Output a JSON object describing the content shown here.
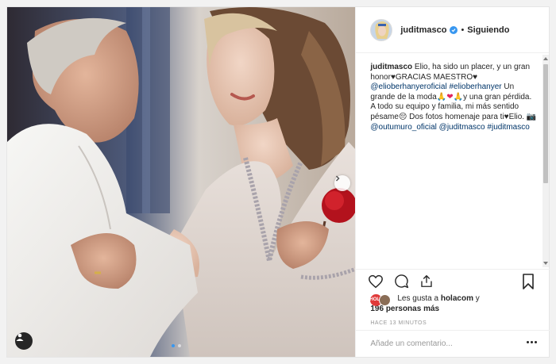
{
  "header": {
    "username": "juditmasco",
    "separator": "•",
    "follow_status": "Siguiendo"
  },
  "caption": {
    "username": "juditmasco",
    "text_1": " Elio, ha sido un placer, y un gran honor",
    "heart": "♥",
    "text_2": "GRACIAS MAESTRO",
    "heart2": "♥",
    "tag_1": "@elioberhanyeroficial",
    "tag_2": "#elioberhanyer",
    "text_3": " Un grande de la moda",
    "emoji_pray": "🙏",
    "emoji_heart": "❤",
    "emoji_pray2": "🙏",
    "text_4": "y una gran pérdida. A todo su equipo y familia, mi más sentido pésame",
    "emoji_sad": "😔",
    "text_5": " Dos fotos homenaje para ti",
    "heart3": "♥",
    "text_6": "Elio. ",
    "emoji_camera": "📷",
    "tag_3": "@outumuro_oficial",
    "tag_4": "@juditmasco",
    "tag_5": "#juditmasco"
  },
  "likes": {
    "avatar_label": "HOLA",
    "prefix": "Les gusta a ",
    "user": "holacom",
    "conj": " y",
    "count": "196 personas más"
  },
  "timestamp": "HACE 13 MINUTOS",
  "comment": {
    "placeholder": "Añade un comentario..."
  },
  "icons": {
    "like": "heart-icon",
    "comment": "comment-icon",
    "share": "share-icon",
    "save": "bookmark-icon",
    "more": "ellipsis-icon",
    "next": "chevron-right-icon",
    "tags": "user-tag-icon"
  },
  "colors": {
    "link": "#003569",
    "accent": "#3897f0",
    "text": "#262626",
    "muted": "#999999"
  }
}
